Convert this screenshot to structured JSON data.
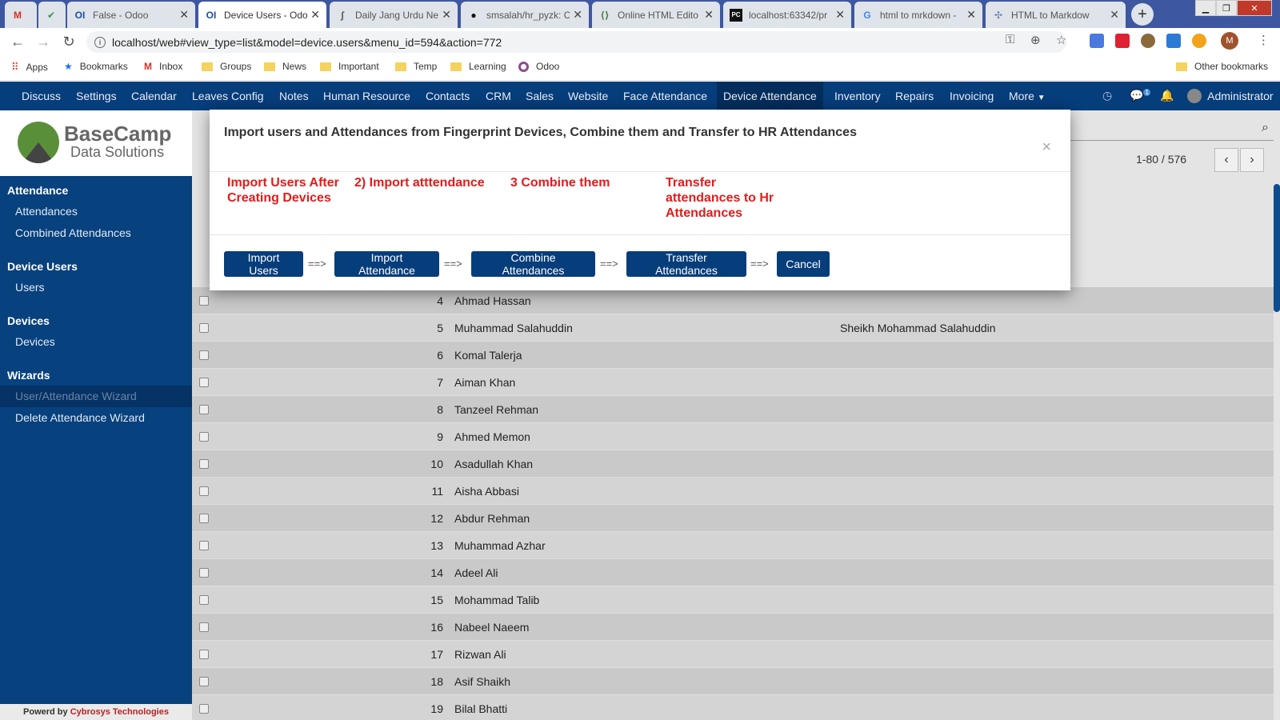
{
  "browser": {
    "tabs": [
      {
        "icon": "gmail-icon",
        "title": ""
      },
      {
        "icon": "check-icon",
        "title": ""
      },
      {
        "icon": "odoo-icon",
        "title": "False - Odoo"
      },
      {
        "icon": "odoo-icon",
        "title": "Device Users - Odo"
      },
      {
        "icon": "jang-icon",
        "title": "Daily Jang Urdu Ne"
      },
      {
        "icon": "github-icon",
        "title": "smsalah/hr_pyzk: C"
      },
      {
        "icon": "code-icon",
        "title": "Online HTML Edito"
      },
      {
        "icon": "pycharm-icon",
        "title": "localhost:63342/pr"
      },
      {
        "icon": "google-icon",
        "title": "html to mrkdown -"
      },
      {
        "icon": "markdown-icon",
        "title": "HTML to Markdow"
      }
    ],
    "url": "localhost/web#view_type=list&model=device.users&menu_id=594&action=772",
    "bookmarks": [
      "Apps",
      "Bookmarks",
      "Inbox",
      "Groups",
      "News",
      "Important",
      "Temp",
      "Learning",
      "Odoo"
    ],
    "other_bookmarks": "Other bookmarks",
    "profile_initial": "M"
  },
  "odoo": {
    "menu": [
      "Discuss",
      "Settings",
      "Calendar",
      "Leaves Config",
      "Notes",
      "Human Resource",
      "Contacts",
      "CRM",
      "Sales",
      "Website",
      "Face Attendance",
      "Device Attendance",
      "Inventory",
      "Repairs",
      "Invoicing",
      "More"
    ],
    "active_menu": "Device Attendance",
    "chat_count": "1",
    "user": "Administrator"
  },
  "logo": {
    "line1": "BaseCamp",
    "line2": "Data Solutions"
  },
  "sidebar": {
    "sections": [
      {
        "header": "Attendance",
        "items": [
          "Attendances",
          "Combined Attendances"
        ]
      },
      {
        "header": "Device Users",
        "items": [
          "Users"
        ]
      },
      {
        "header": "Devices",
        "items": [
          "Devices"
        ]
      },
      {
        "header": "Wizards",
        "items": [
          "User/Attendance Wizard",
          "Delete Attendance Wizard"
        ]
      }
    ],
    "powered_prefix": "Powerd by",
    "powered_brand": "Cybrosys Technologies"
  },
  "list": {
    "pager": "1-80 / 576",
    "rows": [
      {
        "id": "4",
        "name": "Ahmad Hassan",
        "employee": ""
      },
      {
        "id": "5",
        "name": "Muhammad Salahuddin",
        "employee": "Sheikh Mohammad Salahuddin"
      },
      {
        "id": "6",
        "name": "Komal Talerja",
        "employee": ""
      },
      {
        "id": "7",
        "name": "Aiman Khan",
        "employee": ""
      },
      {
        "id": "8",
        "name": "Tanzeel Rehman",
        "employee": ""
      },
      {
        "id": "9",
        "name": "Ahmed Memon",
        "employee": ""
      },
      {
        "id": "10",
        "name": "Asadullah Khan",
        "employee": ""
      },
      {
        "id": "11",
        "name": "Aisha Abbasi",
        "employee": ""
      },
      {
        "id": "12",
        "name": "Abdur Rehman",
        "employee": ""
      },
      {
        "id": "13",
        "name": "Muhammad Azhar",
        "employee": ""
      },
      {
        "id": "14",
        "name": "Adeel Ali",
        "employee": ""
      },
      {
        "id": "15",
        "name": "Mohammad Talib",
        "employee": ""
      },
      {
        "id": "16",
        "name": "Nabeel Naeem",
        "employee": ""
      },
      {
        "id": "17",
        "name": "Rizwan Ali",
        "employee": ""
      },
      {
        "id": "18",
        "name": "Asif Shaikh",
        "employee": ""
      },
      {
        "id": "19",
        "name": "Bilal Bhatti",
        "employee": ""
      }
    ]
  },
  "modal": {
    "title": "Import users and Attendances from Fingerprint Devices, Combine them and Transfer to HR Attendances",
    "steps": [
      "Import Users After Creating Devices",
      "2) Import atttendance",
      "3 Combine them",
      "Transfer attendances to Hr Attendances"
    ],
    "buttons": [
      "Import Users",
      "Import Attendance",
      "Combine Attendances",
      "Transfer Attendances",
      "Cancel"
    ],
    "arrow": "==>"
  }
}
